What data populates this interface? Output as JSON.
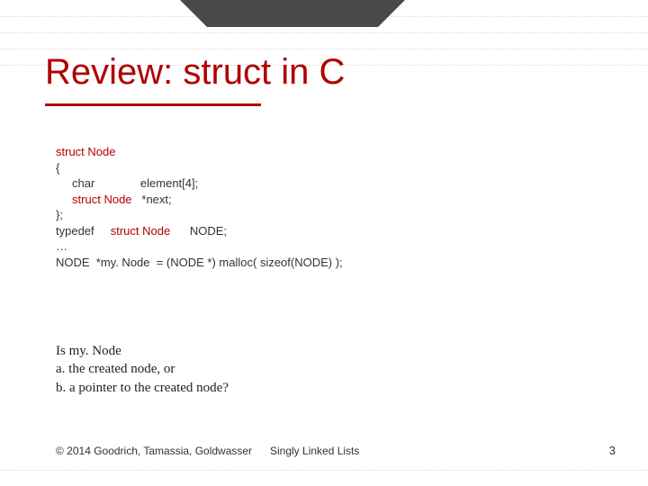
{
  "title": "Review: struct in C",
  "code": {
    "l1_kw": "struct Node",
    "l2": "{",
    "l3a": "     char",
    "l3b": "              element[4];",
    "l4a_kw": "     struct Node",
    "l4b": "   *next;",
    "l5": "};",
    "l6a": "typedef     ",
    "l6b_kw": "struct Node",
    "l6c": "      NODE;",
    "l7": "…",
    "l8": "NODE  *my. Node  = (NODE *) malloc( sizeof(NODE) );"
  },
  "question": {
    "q1": "Is my. Node",
    "q2": "a. the created node, or",
    "q3": "b. a pointer to the created node?"
  },
  "footer": {
    "copyright": "© 2014 Goodrich, Tamassia, Goldwasser",
    "topic": "Singly Linked Lists",
    "page": "3"
  }
}
